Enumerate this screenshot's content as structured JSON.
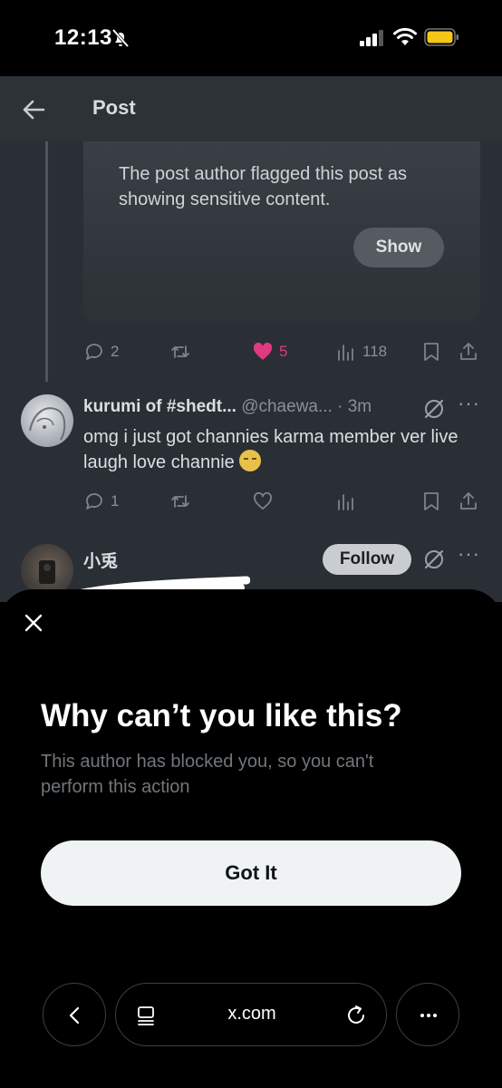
{
  "status_bar": {
    "time": "12:13",
    "icons": [
      "bell-slash-icon",
      "cellular-signal-icon",
      "wifi-icon",
      "battery-icon"
    ],
    "battery_color": "#f5c518"
  },
  "header": {
    "title": "Post",
    "back_icon": "arrow-left-icon"
  },
  "sensitive_post": {
    "notice": "The post author flagged this post as showing sensitive content.",
    "show_label": "Show"
  },
  "post_actions": {
    "replies": "2",
    "likes": "5",
    "views": "118",
    "like_color": "#f91880"
  },
  "reply": {
    "name": "kurumi of #shedt...",
    "handle": "@chaewa...",
    "time": "· 3m",
    "body": "omg i just got channies karma member ver live laugh love channie",
    "actions": {
      "replies": "1"
    }
  },
  "next_post": {
    "name": "小兎",
    "follow_label": "Follow"
  },
  "sheet": {
    "title": "Why can’t you like this?",
    "description": "This author has blocked you, so you can't perform this action",
    "button_label": "Got It"
  },
  "browser": {
    "url": "x.com"
  },
  "colors": {
    "accent_dark_bg": "#000000",
    "dimmed_feed": "#2a2f35",
    "button_light": "#eff3f4"
  }
}
